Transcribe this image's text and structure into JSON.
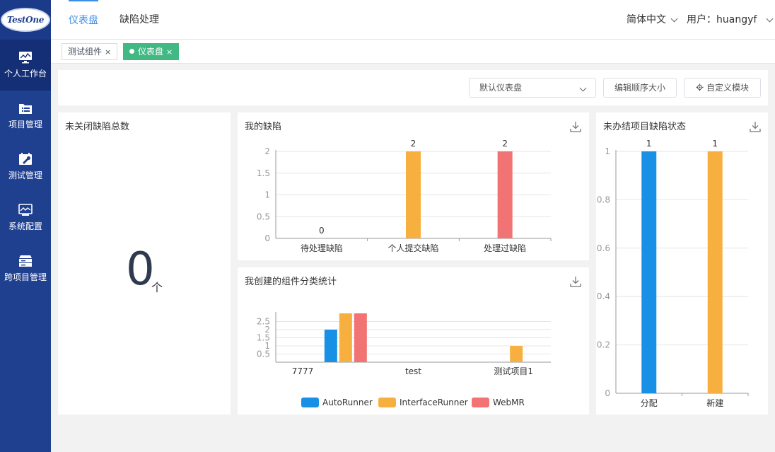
{
  "app": {
    "logo_text": "TestOne"
  },
  "sidebar": {
    "items": [
      {
        "label": "个人工作台",
        "icon": "dashboard-monitor-icon"
      },
      {
        "label": "项目管理",
        "icon": "folder-list-icon"
      },
      {
        "label": "测试管理",
        "icon": "wrench-calendar-icon"
      },
      {
        "label": "系统配置",
        "icon": "settings-monitor-icon"
      },
      {
        "label": "跨项目管理",
        "icon": "server-stack-icon"
      }
    ]
  },
  "header": {
    "tabs": [
      {
        "label": "仪表盘"
      },
      {
        "label": "缺陷处理"
      }
    ],
    "language": "简体中文",
    "user": "用户：huangyf"
  },
  "page_tabs": [
    {
      "label": "测试组件",
      "close": "×"
    },
    {
      "label": "仪表盘",
      "close": "×"
    }
  ],
  "toolbar": {
    "dashboard_select": "默认仪表盘",
    "reorder_button": "编辑顺序大小",
    "customize_button": "自定义模块"
  },
  "cards": {
    "unclosed": {
      "title": "未关闭缺陷总数",
      "value": "0",
      "unit": "个"
    },
    "my_defects": {
      "title": "我的缺陷"
    },
    "components": {
      "title": "我创建的组件分类统计"
    },
    "project_status": {
      "title": "未办结项目缺陷状态"
    }
  },
  "colors": {
    "blue": "#1890e6",
    "orange": "#f7b03f",
    "red": "#f27373",
    "green": "#42b983",
    "sidebar": "#1f3f8f"
  },
  "chart_data": [
    {
      "type": "bar",
      "title": "我的缺陷",
      "categories": [
        "待处理缺陷",
        "个人提交缺陷",
        "处理过缺陷"
      ],
      "values": [
        0,
        2,
        2
      ],
      "colors": [
        "#1890e6",
        "#f7b03f",
        "#f27373"
      ],
      "yticks": [
        "0",
        "0.5",
        "1",
        "1.5",
        "2"
      ],
      "ylim": [
        0,
        2
      ]
    },
    {
      "type": "bar",
      "title": "我创建的组件分类统计",
      "categories": [
        "7777",
        "test",
        "测试项目1"
      ],
      "series": [
        {
          "name": "AutoRunner",
          "values": [
            2,
            0,
            0
          ],
          "color": "#1890e6"
        },
        {
          "name": "InterfaceRunner",
          "values": [
            3,
            0,
            1
          ],
          "color": "#f7b03f"
        },
        {
          "name": "WebMR",
          "values": [
            3,
            0,
            0
          ],
          "color": "#f27373"
        }
      ],
      "yticks": [
        "0.5",
        "1",
        "1.5",
        "2",
        "2.5"
      ],
      "ylim": [
        0,
        3
      ]
    },
    {
      "type": "bar",
      "title": "未办结项目缺陷状态",
      "categories": [
        "分配",
        "新建"
      ],
      "values": [
        1,
        1
      ],
      "colors": [
        "#1890e6",
        "#f7b03f"
      ],
      "yticks": [
        "0",
        "0.2",
        "0.4",
        "0.6",
        "0.8",
        "1"
      ],
      "ylim": [
        0,
        1
      ]
    }
  ]
}
